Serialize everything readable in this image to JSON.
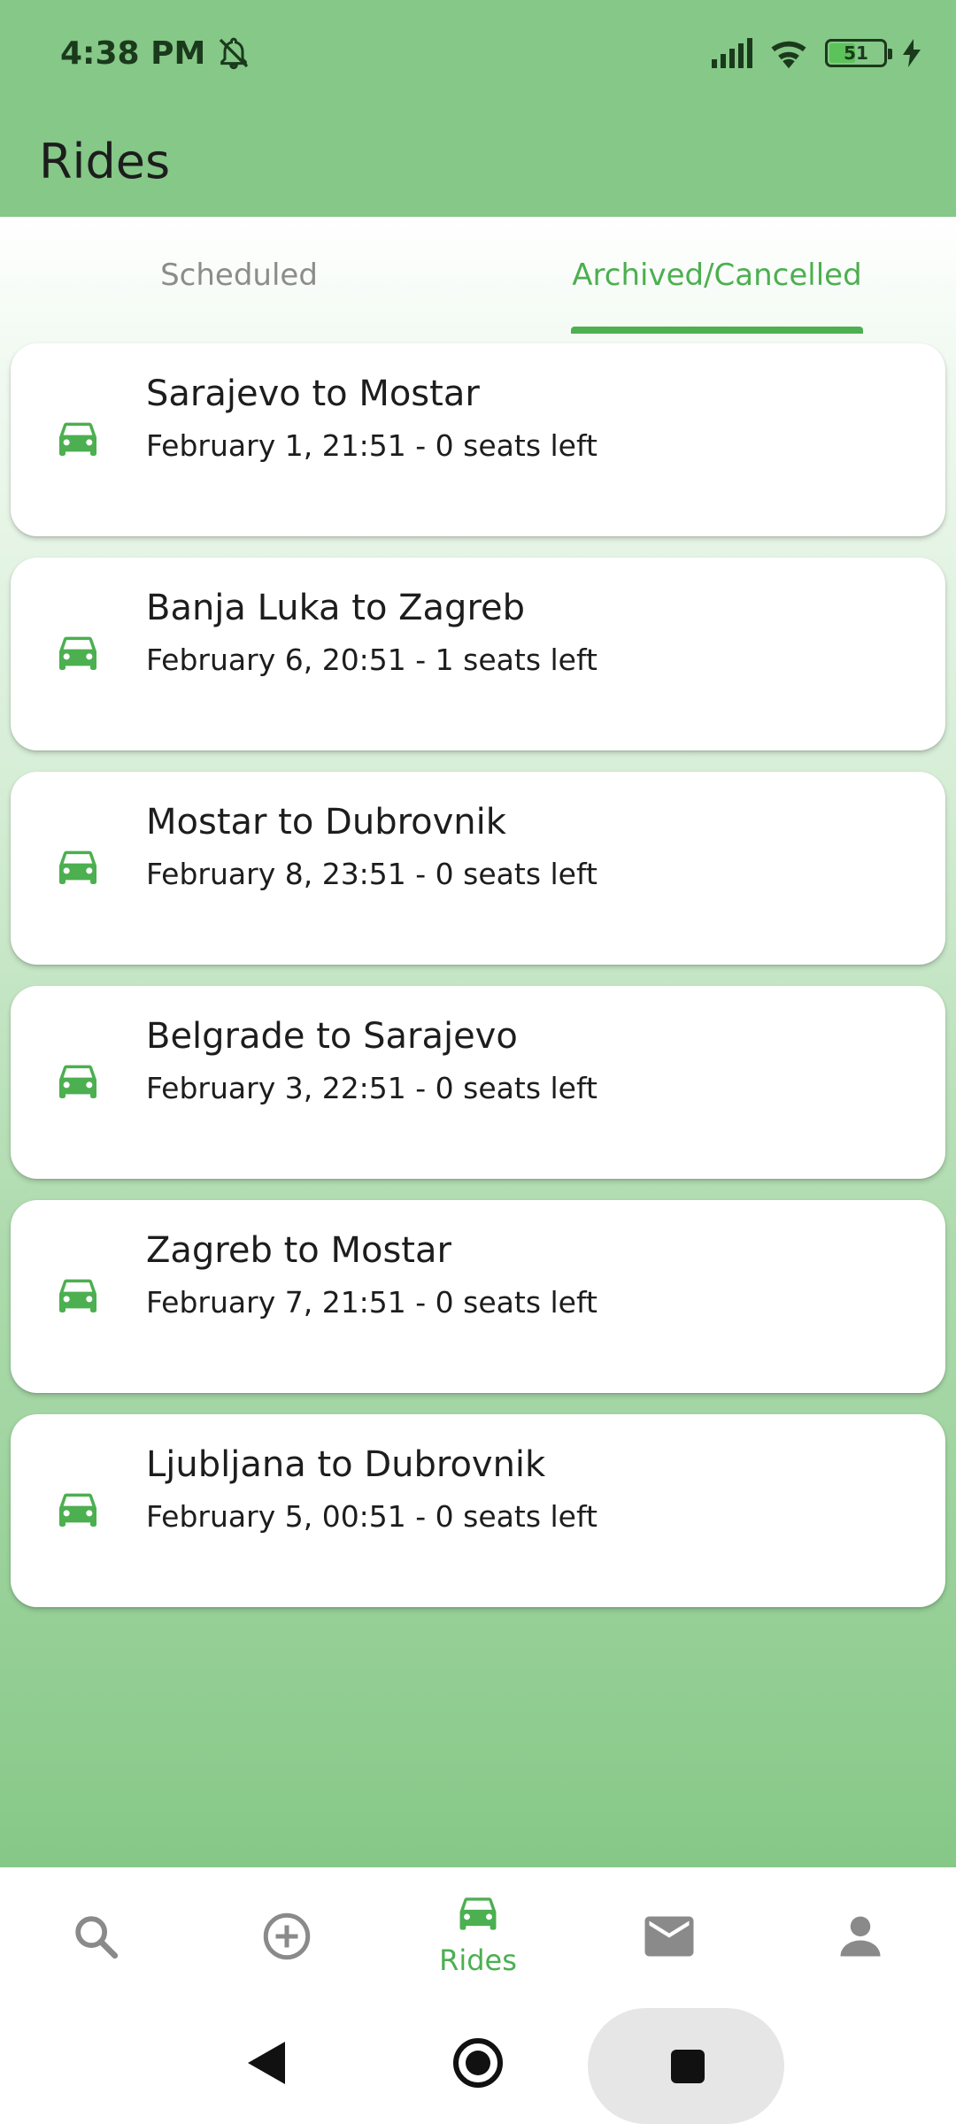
{
  "status_bar": {
    "time": "4:38 PM",
    "battery_level": "51",
    "battery_percent": 51
  },
  "app_bar": {
    "title": "Rides"
  },
  "tabs": [
    {
      "label": "Scheduled",
      "active": false
    },
    {
      "label": "Archived/Cancelled",
      "active": true
    }
  ],
  "rides": [
    {
      "title": "Sarajevo to Mostar",
      "subtitle": "February 1, 21:51 - 0 seats left"
    },
    {
      "title": "Banja Luka to Zagreb",
      "subtitle": "February 6, 20:51 - 1 seats left"
    },
    {
      "title": "Mostar to Dubrovnik",
      "subtitle": "February 8, 23:51 - 0 seats left"
    },
    {
      "title": "Belgrade to Sarajevo",
      "subtitle": "February 3, 22:51 - 0 seats left"
    },
    {
      "title": "Zagreb to Mostar",
      "subtitle": "February 7, 21:51 - 0 seats left"
    },
    {
      "title": "Ljubljana to Dubrovnik",
      "subtitle": "February 5, 00:51 - 0 seats left"
    }
  ],
  "bottom_nav": {
    "items": [
      {
        "icon": "search-icon"
      },
      {
        "icon": "add-circle-icon"
      },
      {
        "icon": "car-icon",
        "label": "Rides",
        "active": true
      },
      {
        "icon": "mail-icon"
      },
      {
        "icon": "person-icon"
      }
    ]
  },
  "colors": {
    "primary": "#4caf50",
    "header_bg": "#85c887",
    "inactive_tab": "#8c8c8c",
    "nav_icon_inactive": "#8a8a8a"
  }
}
